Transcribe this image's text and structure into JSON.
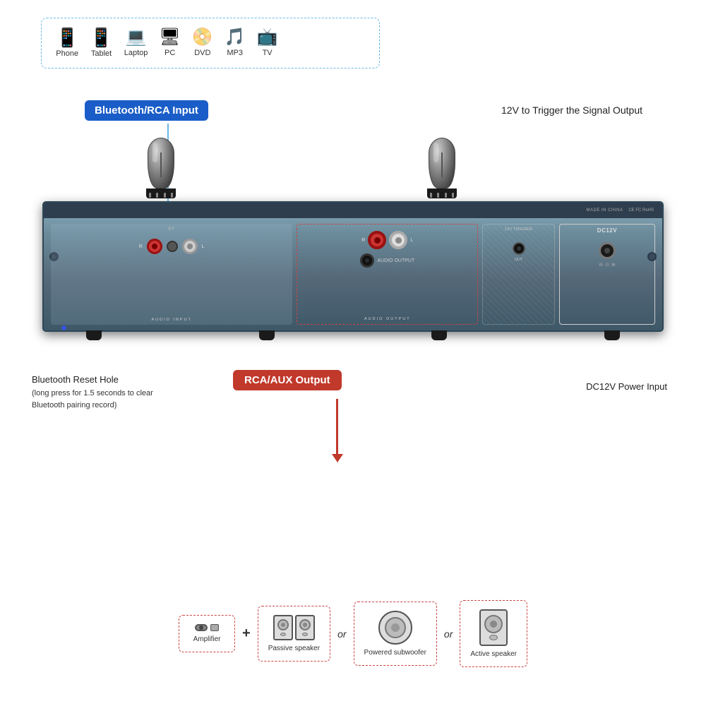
{
  "page": {
    "background": "#ffffff"
  },
  "sources_box": {
    "devices": [
      {
        "id": "phone",
        "icon": "📱",
        "label": "Phone"
      },
      {
        "id": "tablet",
        "icon": "📱",
        "label": "Tablet"
      },
      {
        "id": "laptop",
        "icon": "💻",
        "label": "Laptop"
      },
      {
        "id": "pc",
        "icon": "🖥",
        "label": "PC"
      },
      {
        "id": "dvd",
        "icon": "📀",
        "label": "DVD"
      },
      {
        "id": "mp3",
        "icon": "🎵",
        "label": "MP3"
      },
      {
        "id": "tv",
        "icon": "📺",
        "label": "TV"
      }
    ]
  },
  "annotations": {
    "bluetooth_rca_input": "Bluetooth/RCA Input",
    "trigger_signal": "12V to Trigger the Signal Output",
    "bluetooth_reset_title": "Bluetooth Reset Hole",
    "bluetooth_reset_desc": "(long press for 1.5 seconds to clear\nBluetooth pairing record)",
    "rca_aux_output": "RCA/AUX Output",
    "dc12v_power": "DC12V Power Input"
  },
  "amp": {
    "made_in_china": "MADE IN CHINA",
    "certifications": "CE FC RoHS",
    "audio_input_label": "AUDIO INPUT",
    "audio_output_label": "AUDIO OUTPUT",
    "dc12v_label": "DC12V",
    "trigger_label": "12V TRIGGER",
    "trigger_out": "OUT"
  },
  "output_devices": [
    {
      "id": "amplifier",
      "label": "Amplifier",
      "type": "amplifier"
    },
    {
      "id": "passive_speaker",
      "label": "Passive speaker",
      "type": "passive"
    },
    {
      "id": "powered_subwoofer",
      "label": "Powered subwoofer",
      "type": "subwoofer"
    },
    {
      "id": "active_speaker",
      "label": "Active speaker",
      "type": "active"
    }
  ],
  "colors": {
    "blue_badge": "#1a5dc8",
    "red_badge": "#c0392b",
    "dashed_border": "#6bb8e8",
    "red_dashed": "#c44444",
    "arrow_blue": "#6bb8e8",
    "arrow_red": "#c0392b"
  }
}
